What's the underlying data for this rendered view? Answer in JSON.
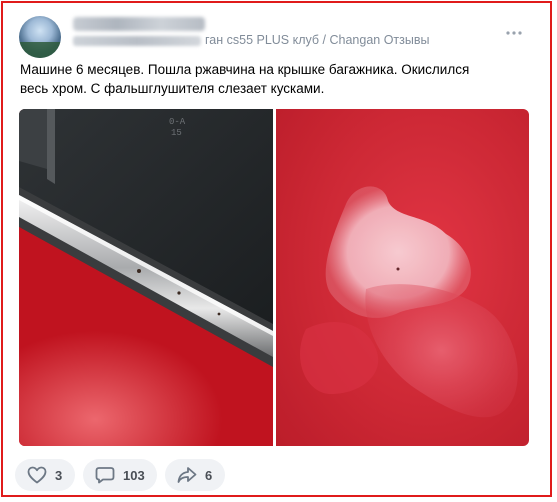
{
  "post": {
    "meta_suffix": "ган cs55 PLUS клуб / Changan Отзывы",
    "text": "Машине 6 месяцев. Пошла ржавчина на крышке багажника. Окислился весь хром. С фальшглушителя слезает кусками."
  },
  "actions": {
    "likes": "3",
    "comments": "103",
    "shares": "6"
  },
  "icons": {
    "more": "more-horizontal-icon",
    "like": "heart-icon",
    "comment": "comment-bubble-icon",
    "share": "share-arrow-icon"
  },
  "colors": {
    "frame_border": "#e01b1b",
    "action_bg": "#f0f2f5",
    "meta_text": "#818c99"
  }
}
